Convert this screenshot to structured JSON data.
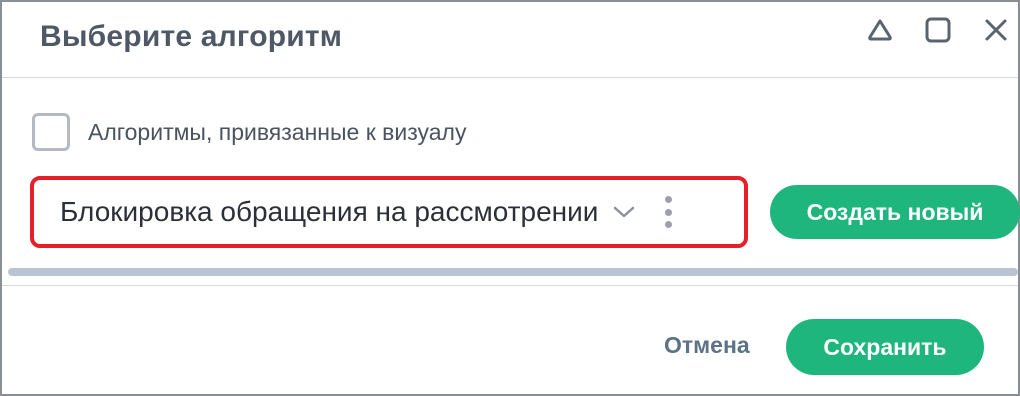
{
  "dialog": {
    "title": "Выберите алгоритм",
    "header_icons": [
      "collapse-icon",
      "maximize-icon",
      "close-icon"
    ]
  },
  "checkbox": {
    "label": "Алгоритмы, привязанные к визуалу",
    "checked": false
  },
  "algorithm_select": {
    "value": "Блокировка обращения на рассмотрении",
    "icons": [
      "chevron-down-icon",
      "more-vertical-icon"
    ]
  },
  "buttons": {
    "create_new": "Создать новый",
    "cancel": "Отмена",
    "save": "Сохранить"
  },
  "colors": {
    "accent": "#1fb67e",
    "highlight_border": "#e4202a",
    "title": "#4f5966",
    "link": "#5c7288"
  }
}
